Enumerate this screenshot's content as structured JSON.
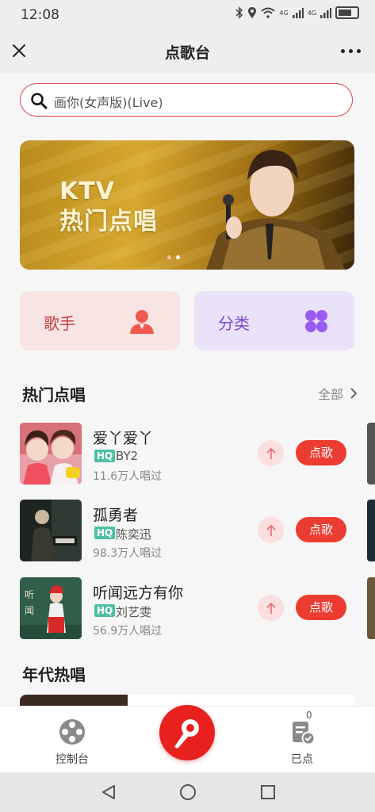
{
  "status_bar": {
    "time": "12:08",
    "network1": "4G",
    "network2": "4G"
  },
  "header": {
    "title": "点歌台"
  },
  "search": {
    "placeholder": "画你(女声版)(Live)"
  },
  "banner": {
    "line1": "KTV",
    "line2": "热门点唱",
    "dots": 2,
    "active_dot": 2
  },
  "categories": [
    {
      "label": "歌手",
      "icon": "singer-icon",
      "color": "#c84040"
    },
    {
      "label": "分类",
      "icon": "category-icon",
      "color": "#7b4ad0"
    }
  ],
  "hot_section": {
    "title": "热门点唱",
    "see_all": "全部"
  },
  "songs": [
    {
      "title": "爱丫爱丫",
      "badge": "HQ",
      "artist": "BY2",
      "count": "11.6万人唱过",
      "action": "点歌"
    },
    {
      "title": "孤勇者",
      "badge": "HQ",
      "artist": "陈奕迅",
      "count": "98.3万人唱过",
      "action": "点歌"
    },
    {
      "title": "听闻远方有你",
      "badge": "HQ",
      "artist": "刘艺雯",
      "count": "56.9万人唱过",
      "action": "点歌"
    }
  ],
  "era_section": {
    "title": "年代热唱"
  },
  "bottom_nav": {
    "console_label": "控制台",
    "queue_label": "已点",
    "queue_count": "0"
  },
  "colors": {
    "accent": "#ec3c32",
    "hq": "#4fbfa5"
  }
}
